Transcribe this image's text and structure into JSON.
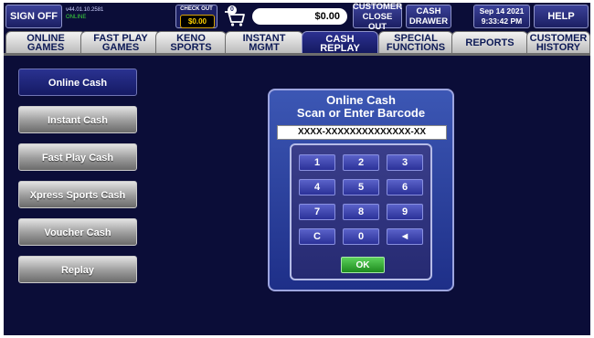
{
  "topbar": {
    "sign_off": "SIGN OFF",
    "version": "v44.01.10.2581",
    "connection_status": "ONLINE",
    "checkout_label": "CHECK OUT",
    "checkout_amount": "$0.00",
    "cart_count": "0",
    "balance": "$0.00",
    "customer_close_out": [
      "CUSTOMER",
      "CLOSE OUT"
    ],
    "cash_drawer": [
      "CASH",
      "DRAWER"
    ],
    "date": "Sep 14 2021",
    "time": "9:33:42 PM",
    "help": "HELP"
  },
  "tabs": [
    {
      "line1": "ONLINE",
      "line2": "GAMES"
    },
    {
      "line1": "FAST PLAY",
      "line2": "GAMES"
    },
    {
      "line1": "KENO",
      "line2": "SPORTS"
    },
    {
      "line1": "INSTANT",
      "line2": "MGMT"
    },
    {
      "line1": "CASH",
      "line2": "REPLAY",
      "active": true
    },
    {
      "line1": "SPECIAL",
      "line2": "FUNCTIONS"
    },
    {
      "line1": "REPORTS",
      "line2": ""
    },
    {
      "line1": "CUSTOMER",
      "line2": "HISTORY"
    }
  ],
  "sidebar": {
    "items": [
      {
        "label": "Online Cash",
        "selected": true
      },
      {
        "label": "Instant Cash"
      },
      {
        "label": "Fast Play Cash"
      },
      {
        "label": "Xpress Sports Cash"
      },
      {
        "label": "Voucher Cash"
      },
      {
        "label": "Replay"
      }
    ]
  },
  "dialog": {
    "title": "Online Cash",
    "subtitle": "Scan or Enter Barcode",
    "barcode_value": "XXXX-XXXXXXXXXXXXXX-XX",
    "keys": [
      "1",
      "2",
      "3",
      "4",
      "5",
      "6",
      "7",
      "8",
      "9",
      "C",
      "0",
      "◄"
    ],
    "ok": "OK"
  },
  "colors": {
    "background": "#0b0d38",
    "active_tab": "#1d2270",
    "ok_green": "#2aa52a",
    "amount_yellow": "#ffd200"
  }
}
